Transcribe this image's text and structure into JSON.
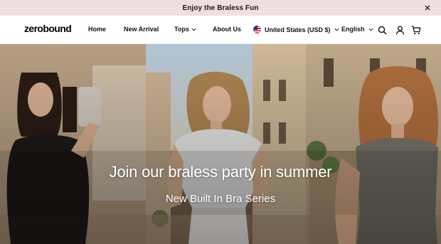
{
  "announcement": {
    "text": "Enjoy the Braless Fun",
    "close_icon": "close-icon"
  },
  "header": {
    "logo": "zerobound",
    "nav": [
      {
        "label": "Home"
      },
      {
        "label": "New Arrival"
      },
      {
        "label": "Tops",
        "has_dropdown": true
      },
      {
        "label": "About Us"
      }
    ],
    "country": {
      "label": "United States (USD $)",
      "icon": "us-flag-icon"
    },
    "language": {
      "label": "English"
    },
    "icons": [
      "search-icon",
      "account-icon",
      "cart-icon"
    ]
  },
  "hero": {
    "title": "Join our braless party in summer",
    "subtitle": "New Built In Bra Series"
  },
  "colors": {
    "announcement_bg": "#f1dede",
    "header_bg": "#ffffff",
    "hero_text": "#ffffff"
  }
}
